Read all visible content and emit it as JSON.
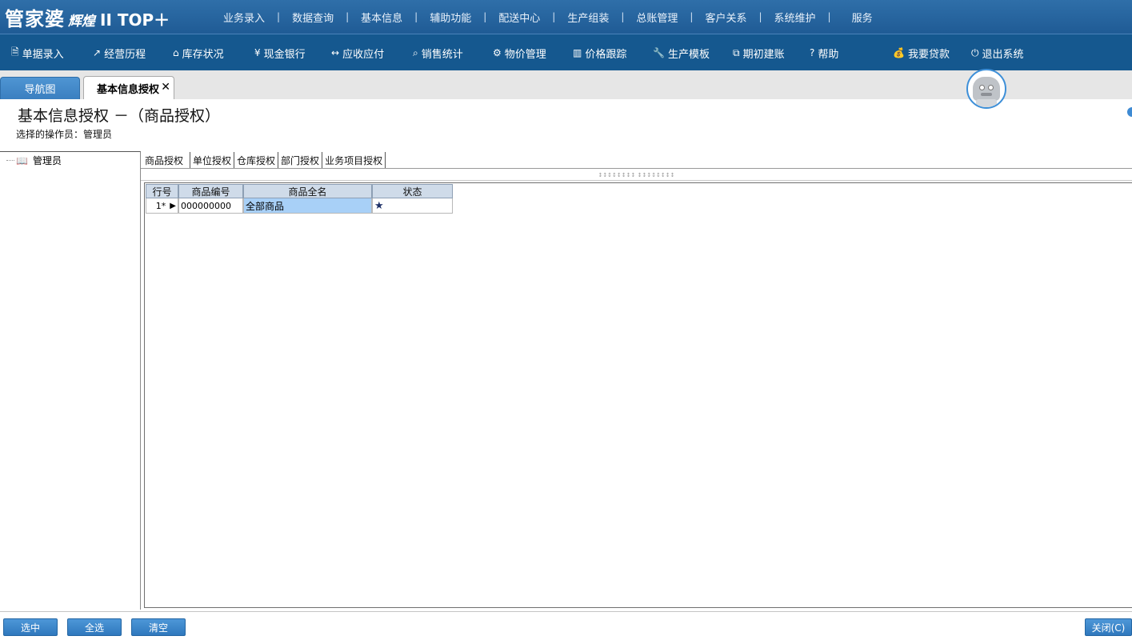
{
  "logo": {
    "part1": "管家婆",
    "part2": "辉煌",
    "part3": "II TOP＋"
  },
  "top_menu": [
    "业务录入",
    "数据查询",
    "基本信息",
    "辅助功能",
    "配送中心",
    "生产组装",
    "总账管理",
    "客户关系",
    "系统维护",
    "服务"
  ],
  "toolbar": [
    {
      "icon": "document-icon",
      "glyph": "🗎",
      "label": "单据录入"
    },
    {
      "icon": "chart-line-icon",
      "glyph": "↗",
      "label": "经营历程"
    },
    {
      "icon": "home-icon",
      "glyph": "⌂",
      "label": "库存状况"
    },
    {
      "icon": "yen-icon",
      "glyph": "¥",
      "label": "现金银行"
    },
    {
      "icon": "arrows-icon",
      "glyph": "↔",
      "label": "应收应付"
    },
    {
      "icon": "search-icon",
      "glyph": "⌕",
      "label": "销售统计"
    },
    {
      "icon": "gear-icon",
      "glyph": "⚙",
      "label": "物价管理"
    },
    {
      "icon": "bar-chart-icon",
      "glyph": "▥",
      "label": "价格跟踪"
    },
    {
      "icon": "wrench-icon",
      "glyph": "🔧",
      "label": "生产模板"
    },
    {
      "icon": "external-link-icon",
      "glyph": "⧉",
      "label": "期初建账"
    },
    {
      "icon": "question-icon",
      "glyph": "?",
      "label": "帮助"
    },
    {
      "icon": "money-bag-icon",
      "glyph": "💰",
      "label": "我要贷款"
    },
    {
      "icon": "power-icon",
      "glyph": "⏻",
      "label": "退出系统"
    }
  ],
  "tabs": {
    "nav": "导航图",
    "active": "基本信息授权",
    "close": "✕"
  },
  "page": {
    "title": "基本信息授权 －（商品授权）",
    "operator_label": "选择的操作员：",
    "operator_value": "管理员"
  },
  "tree": {
    "root_label": "管理员"
  },
  "subtabs": [
    "商品授权",
    "单位授权",
    "仓库授权",
    "部门授权",
    "业务项目授权"
  ],
  "grip": "↕↕↕↕↕↕↕↕  ↕↕↕↕↕↕↕↕",
  "grid": {
    "headers": [
      "行号",
      "商品编号",
      "商品全名",
      "状态"
    ],
    "rows": [
      {
        "row_no": "1*",
        "marker": "▶",
        "code": "000000000",
        "name": "全部商品",
        "status": "★"
      }
    ]
  },
  "buttons": {
    "select": "选中",
    "select_all": "全选",
    "clear": "清空",
    "close": "关闭(C)"
  },
  "colors": {
    "topbar": "#2f6fa9",
    "toolbar": "#15588f",
    "button": "#2f78bd",
    "selection": "#a8d0f7",
    "header": "#cfdbe9"
  }
}
